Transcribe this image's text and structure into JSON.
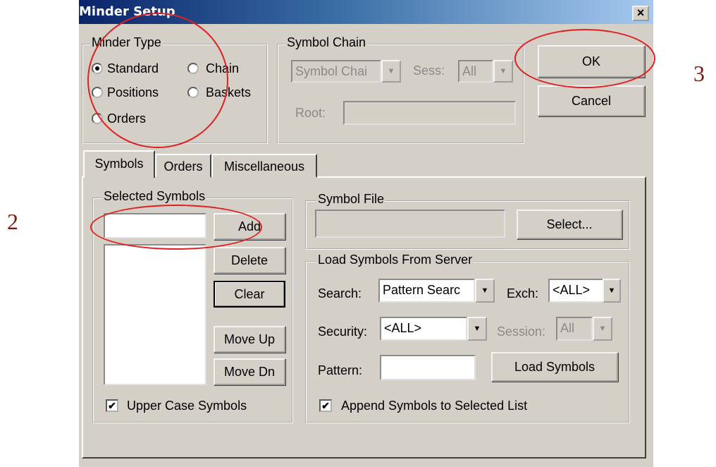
{
  "window": {
    "title": "Minder Setup",
    "close_glyph": "×"
  },
  "minder_type": {
    "label": "Minder Type",
    "options": [
      {
        "label": "Standard",
        "selected": true
      },
      {
        "label": "Chain",
        "selected": false
      },
      {
        "label": "Positions",
        "selected": false
      },
      {
        "label": "Baskets",
        "selected": false
      },
      {
        "label": "Orders",
        "selected": false
      }
    ]
  },
  "symbol_chain": {
    "label": "Symbol Chain",
    "chain_value": "Symbol Chai",
    "sess_label": "Sess:",
    "sess_value": "All",
    "root_label": "Root:",
    "root_value": ""
  },
  "actions": {
    "ok": "OK",
    "cancel": "Cancel"
  },
  "tabs": [
    "Symbols",
    "Orders",
    "Miscellaneous"
  ],
  "selected_symbols": {
    "label": "Selected Symbols",
    "input_value": "",
    "add": "Add",
    "delete": "Delete",
    "clear": "Clear",
    "move_up": "Move Up",
    "move_dn": "Move Dn",
    "upper_case_label": "Upper Case Symbols",
    "upper_case_checked": true
  },
  "symbol_file": {
    "label": "Symbol File",
    "path_value": "",
    "select": "Select..."
  },
  "load_from_server": {
    "label": "Load Symbols From Server",
    "search_label": "Search:",
    "search_value": "Pattern Searc",
    "exch_label": "Exch:",
    "exch_value": "<ALL>",
    "security_label": "Security:",
    "security_value": "<ALL>",
    "session_label": "Session:",
    "session_value": "All",
    "pattern_label": "Pattern:",
    "pattern_value": "",
    "load_button": "Load Symbols",
    "append_label": "Append Symbols to Selected List",
    "append_checked": true
  },
  "annotations": {
    "label_2": "2",
    "label_3": "3",
    "circle_color": "#e02020"
  },
  "colors": {
    "face": "#d4d0c8",
    "title_start": "#0a246a",
    "title_end": "#a6caf0"
  }
}
